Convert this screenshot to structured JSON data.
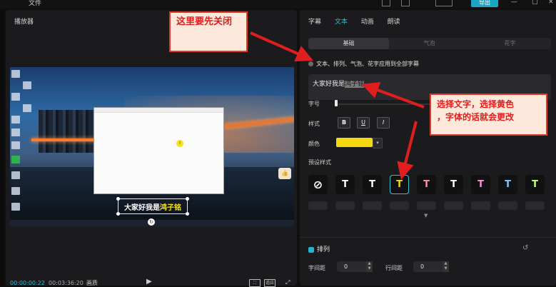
{
  "topbar": {
    "menu": "文件",
    "export_label": "导出",
    "min": "—",
    "close": "✕"
  },
  "player": {
    "title": "播放器",
    "subtitle_plain": "大家好我是",
    "subtitle_highlight": "鸿子铭",
    "current_time": "00:00:00:22",
    "total_time": "00:03:36:20",
    "quality": "画质",
    "fit_label": "适应"
  },
  "panel": {
    "tabs": [
      {
        "label": "字幕"
      },
      {
        "label": "文本"
      },
      {
        "label": "动画"
      },
      {
        "label": "朗读"
      }
    ],
    "subtabs": [
      {
        "label": "基础"
      },
      {
        "label": "气泡"
      },
      {
        "label": "花字"
      }
    ],
    "apply_all_label": "文本、排列、气泡、花字应用到全部字幕",
    "text_plain": "大家好我是",
    "text_selected": "鸿子铭",
    "font_size_label": "字号",
    "style_label": "样式",
    "style_buttons": [
      "B",
      "U",
      "I"
    ],
    "color_label": "颜色",
    "color_value": "#f5d90e",
    "preset_label": "预设样式",
    "presets": [
      {
        "glyph": "⃠",
        "color": "#ffffff"
      },
      {
        "glyph": "T",
        "color": "#ffffff"
      },
      {
        "glyph": "T",
        "color": "#ffffff"
      },
      {
        "glyph": "T",
        "color": "#f5d90e"
      },
      {
        "glyph": "T",
        "color": "#ff8fa3"
      },
      {
        "glyph": "T",
        "color": "#ffffff"
      },
      {
        "glyph": "T",
        "color": "#ff8fd0"
      },
      {
        "glyph": "T",
        "color": "#7ec8ff"
      },
      {
        "glyph": "T",
        "color": "#c8ff7e"
      }
    ],
    "arrange_label": "排列",
    "letter_spacing_label": "字间距",
    "letter_spacing_value": "0",
    "line_spacing_label": "行间距",
    "line_spacing_value": "0"
  },
  "annotations": {
    "note1": "这里要先关闭",
    "note2_line1": "选择文字，选择黄色",
    "note2_line2": "，字体的话就会更改",
    "arrow_color": "#e01e1e"
  }
}
